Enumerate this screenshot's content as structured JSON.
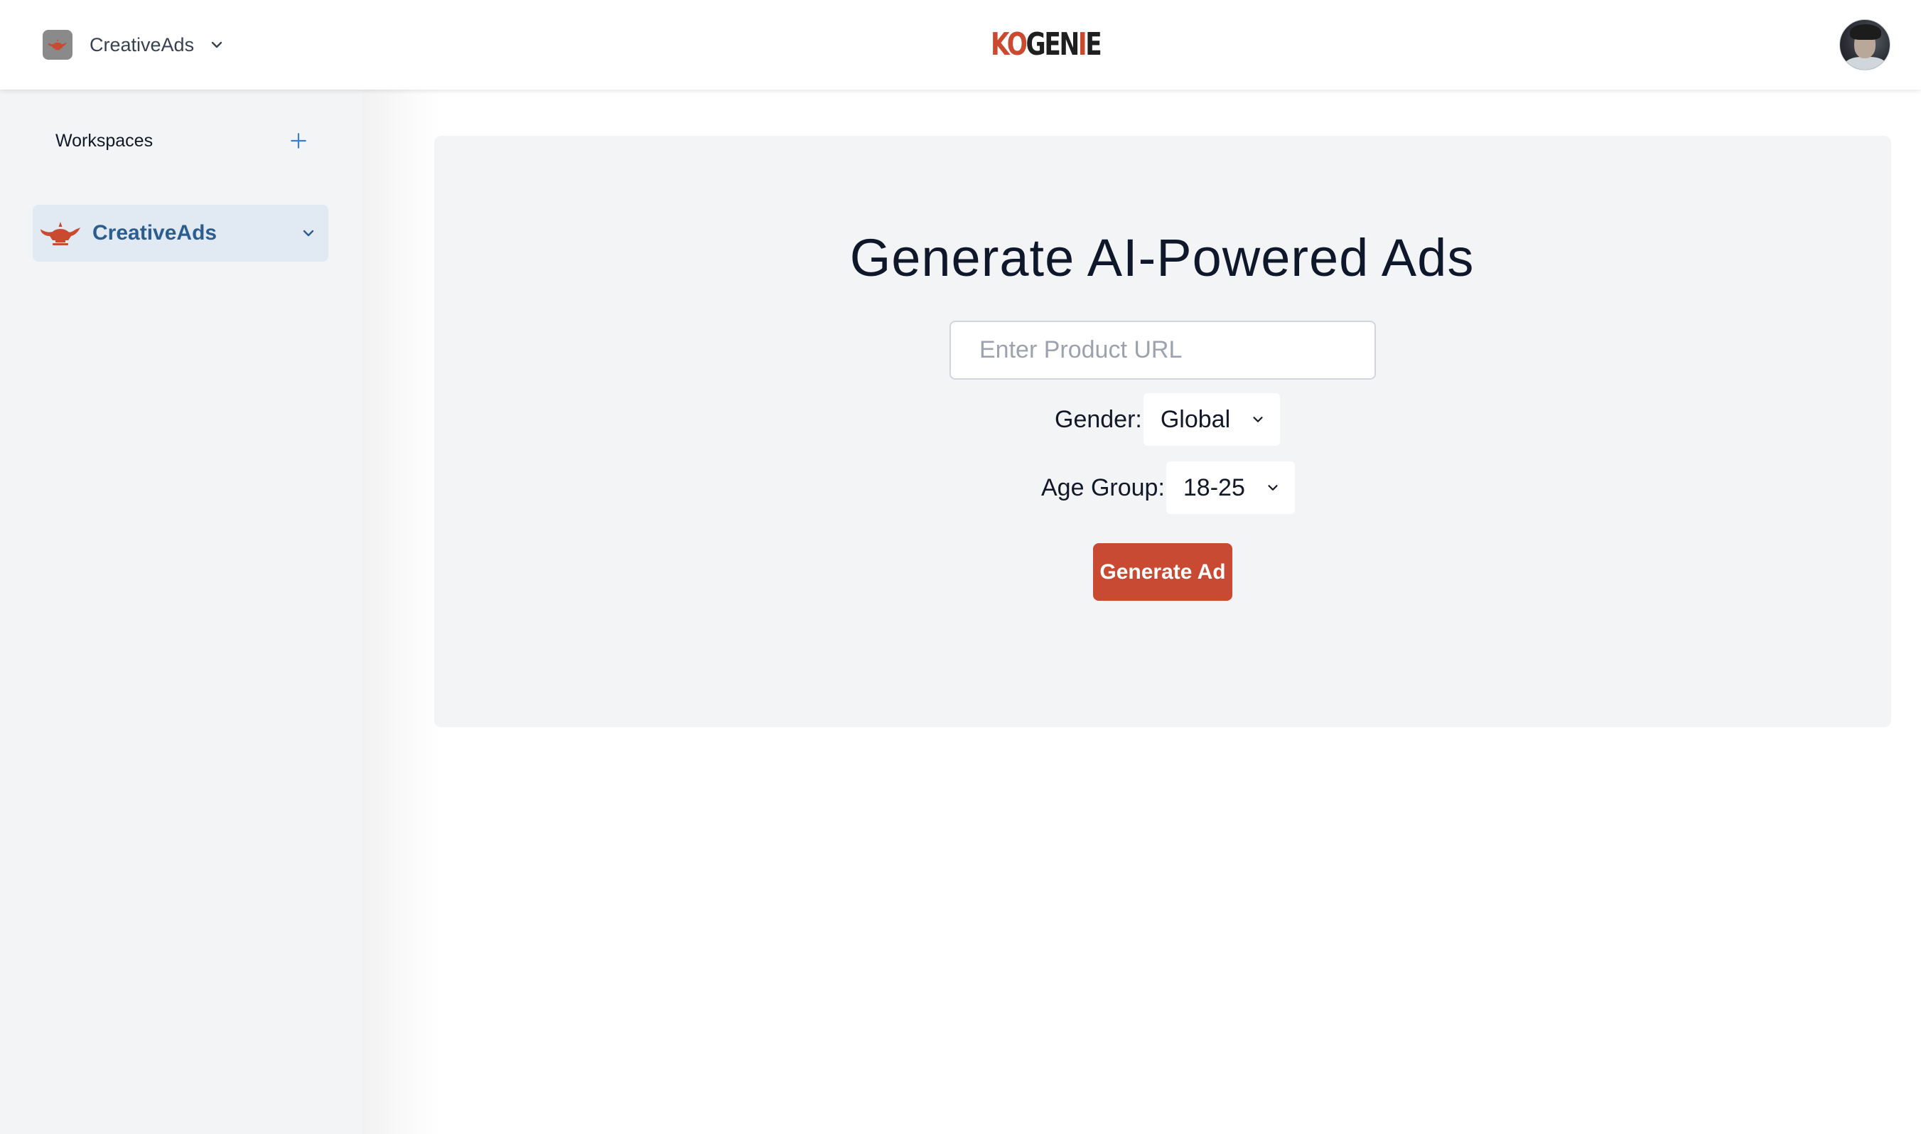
{
  "header": {
    "workspace_name": "CreativeAds",
    "brand": {
      "part1": "KO",
      "part2": "GEN",
      "part3": "I",
      "part4": "E"
    },
    "colors": {
      "brand_red": "#c94a2e",
      "brand_dark": "#1f1f1f"
    }
  },
  "sidebar": {
    "title": "Workspaces",
    "add_icon": "plus-icon",
    "items": [
      {
        "label": "CreativeAds",
        "icon": "genie-lamp-icon",
        "selected": true
      }
    ]
  },
  "main": {
    "headline": "Generate AI-Powered Ads",
    "url_input": {
      "placeholder": "Enter Product URL",
      "value": ""
    },
    "gender": {
      "label": "Gender:",
      "selected": "Global"
    },
    "age_group": {
      "label": "Age Group:",
      "selected": "18-25"
    },
    "generate_button": "Generate Ad",
    "colors": {
      "accent": "#c94a33",
      "card_bg": "#f3f4f6",
      "sidebar_selected_bg": "#e1e9f2",
      "sidebar_selected_text": "#2c5d8f"
    }
  }
}
